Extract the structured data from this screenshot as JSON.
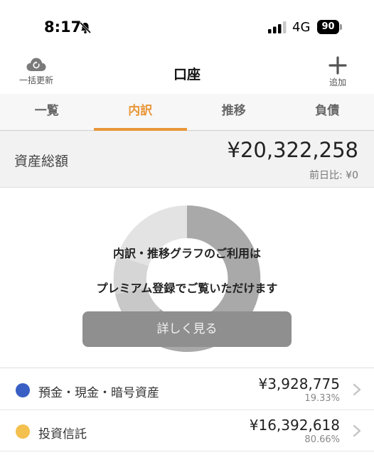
{
  "status_bar": {
    "time": "8:17",
    "network": "4G",
    "battery": "90"
  },
  "header": {
    "refresh_label": "一括更新",
    "title": "口座",
    "add_label": "追加"
  },
  "tabs": [
    {
      "label": "一覧",
      "active": false
    },
    {
      "label": "内訳",
      "active": true
    },
    {
      "label": "推移",
      "active": false
    },
    {
      "label": "負債",
      "active": false
    }
  ],
  "total": {
    "label": "資産総額",
    "value": "¥20,322,258",
    "change": "前日比: ¥0"
  },
  "premium_overlay": {
    "line1": "内訳・推移グラフのご利用は",
    "line2": "プレミアム登録でご覧いただけます",
    "button_label": "詳しく見る"
  },
  "assets": [
    {
      "name": "預金・現金・暗号資産",
      "amount": "¥3,928,775",
      "percent": "19.33%",
      "color": "#3a5fc4"
    },
    {
      "name": "投資信託",
      "amount": "¥16,392,618",
      "percent": "80.66%",
      "color": "#f4c04e"
    }
  ],
  "colors": {
    "accent": "#e8973a",
    "donut_segments": [
      "#a9a9a9",
      "#c8c8c8",
      "#d6d6d6",
      "#e3e3e3"
    ]
  }
}
